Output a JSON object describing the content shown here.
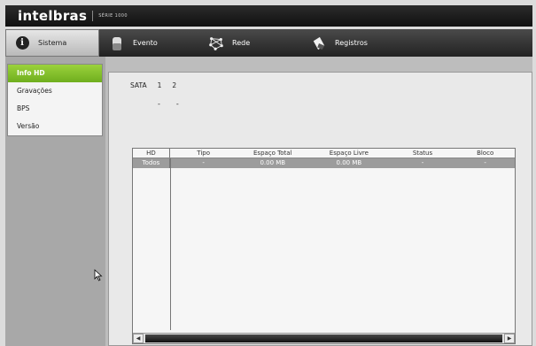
{
  "brand": {
    "logo": "intelbras",
    "series": "SÉRIE 1000"
  },
  "menu": [
    {
      "label": "Sistema",
      "icon": "info-icon",
      "active": true
    },
    {
      "label": "Evento",
      "icon": "alarm-icon",
      "active": false
    },
    {
      "label": "Rede",
      "icon": "network-icon",
      "active": false
    },
    {
      "label": "Registros",
      "icon": "log-icon",
      "active": false
    }
  ],
  "sidebar": {
    "items": [
      {
        "label": "Info HD",
        "active": true
      },
      {
        "label": "Gravações",
        "active": false
      },
      {
        "label": "BPS",
        "active": false
      },
      {
        "label": "Versão",
        "active": false
      }
    ]
  },
  "sata": {
    "label": "SATA",
    "ports": [
      "1",
      "2"
    ],
    "status": [
      "-",
      "-"
    ]
  },
  "table": {
    "columns": [
      "HD",
      "Tipo",
      "Espaço Total",
      "Espaço Livre",
      "Status",
      "Bloco"
    ],
    "rows": [
      [
        "Todos",
        "-",
        "0.00 MB",
        "0.00 MB",
        "-",
        "-"
      ]
    ]
  },
  "colors": {
    "active_green": "#7fbf2a",
    "bar_dark": "#1a1a1a",
    "row_gray": "#9c9c9c"
  }
}
